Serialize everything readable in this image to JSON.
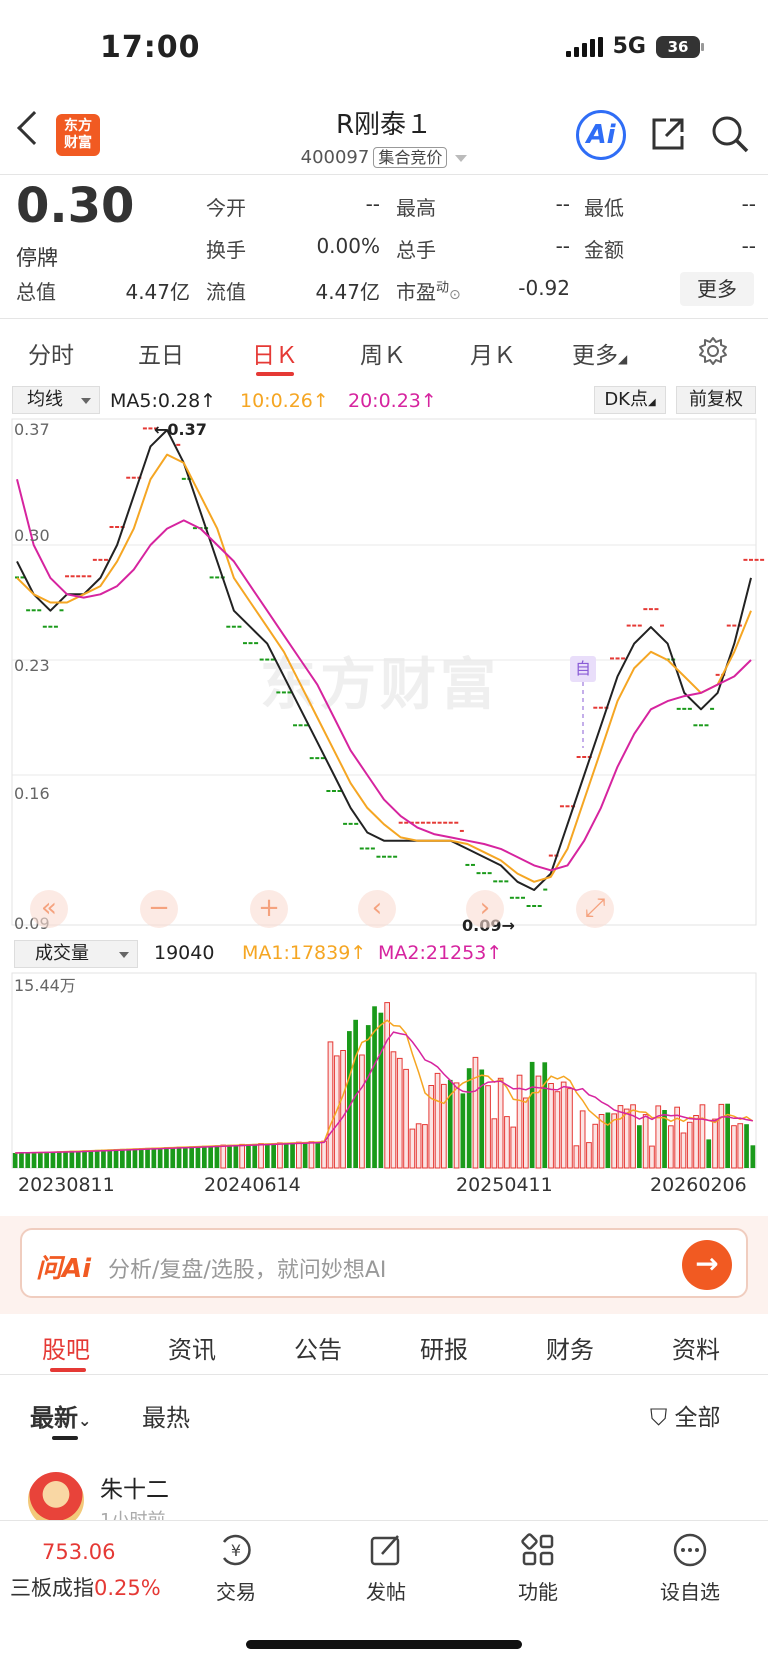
{
  "status_bar": {
    "time": "17:00",
    "network": "5G",
    "battery": "36"
  },
  "header": {
    "stock_name": "R刚泰１",
    "code": "400097",
    "auction_tag": "集合竞价",
    "logo_line1": "东方",
    "logo_line2": "财富",
    "ai_label": "Ai"
  },
  "quote": {
    "price": "0.30",
    "status": "停牌",
    "open_label": "今开",
    "open": "--",
    "high_label": "最高",
    "high": "--",
    "low_label": "最低",
    "low": "--",
    "turnover_label": "换手",
    "turnover": "0.00%",
    "volume_label": "总手",
    "volume": "--",
    "amount_label": "金额",
    "amount": "--",
    "total_cap_label": "总值",
    "total_cap": "4.47亿",
    "float_cap_label": "流值",
    "float_cap": "4.47亿",
    "pe_label": "市盈",
    "pe_sup": "动",
    "pe": "-0.92",
    "more": "更多"
  },
  "period_tabs": [
    "分时",
    "五日",
    "日Ｋ",
    "周Ｋ",
    "月Ｋ",
    "更多"
  ],
  "ma_legend": {
    "select": "均线",
    "ma5": "MA5:0.28↑",
    "ma10": "10:0.26↑",
    "ma20": "20:0.23↑",
    "dk": "DK点",
    "adjust": "前复权",
    "colors": {
      "ma5": "#222222",
      "ma10": "#f5a623",
      "ma20": "#d6249f",
      "up": "#e53935",
      "down": "#1a9a1a"
    }
  },
  "price_axis": {
    "labels": [
      "0.37",
      "0.30",
      "0.23",
      "0.16",
      "0.09"
    ]
  },
  "annotations": {
    "high": "←0.37",
    "low": "0.09→",
    "self_tag": "自",
    "watermark": "东方财富"
  },
  "volume": {
    "select": "成交量",
    "value": "19040",
    "ma1": "MA1:17839↑",
    "ma2": "MA2:21253↑",
    "max_label": "15.44万",
    "dates": [
      "20230811",
      "20240614",
      "20250411",
      "20260206"
    ]
  },
  "chart_data": [
    {
      "type": "line",
      "title": "",
      "series": [
        {
          "name": "MA5",
          "values": [
            0.29,
            0.27,
            0.26,
            0.27,
            0.27,
            0.28,
            0.3,
            0.33,
            0.36,
            0.37,
            0.35,
            0.32,
            0.29,
            0.26,
            0.25,
            0.24,
            0.22,
            0.2,
            0.18,
            0.16,
            0.14,
            0.125,
            0.12,
            0.12,
            0.12,
            0.12,
            0.12,
            0.115,
            0.11,
            0.105,
            0.095,
            0.09,
            0.1,
            0.13,
            0.16,
            0.19,
            0.22,
            0.24,
            0.25,
            0.24,
            0.21,
            0.2,
            0.21,
            0.24,
            0.28
          ]
        },
        {
          "name": "MA10",
          "values": [
            0.28,
            0.27,
            0.265,
            0.265,
            0.27,
            0.275,
            0.29,
            0.31,
            0.34,
            0.355,
            0.35,
            0.33,
            0.31,
            0.28,
            0.265,
            0.25,
            0.235,
            0.215,
            0.195,
            0.175,
            0.155,
            0.14,
            0.13,
            0.122,
            0.12,
            0.12,
            0.12,
            0.118,
            0.113,
            0.108,
            0.1,
            0.095,
            0.098,
            0.115,
            0.145,
            0.175,
            0.205,
            0.225,
            0.235,
            0.23,
            0.22,
            0.21,
            0.215,
            0.235,
            0.26
          ]
        },
        {
          "name": "MA20",
          "values": [
            0.34,
            0.3,
            0.28,
            0.27,
            0.268,
            0.27,
            0.275,
            0.285,
            0.3,
            0.31,
            0.315,
            0.31,
            0.3,
            0.29,
            0.275,
            0.26,
            0.245,
            0.23,
            0.215,
            0.195,
            0.175,
            0.16,
            0.145,
            0.135,
            0.128,
            0.124,
            0.122,
            0.12,
            0.118,
            0.115,
            0.11,
            0.105,
            0.102,
            0.105,
            0.12,
            0.14,
            0.165,
            0.185,
            0.2,
            0.205,
            0.208,
            0.21,
            0.215,
            0.22,
            0.23
          ]
        }
      ],
      "ylim": [
        0.09,
        0.37
      ],
      "high": 0.37,
      "low": 0.09
    },
    {
      "type": "bar",
      "title": "",
      "dates": [
        "20230811",
        "20240614",
        "20250411",
        "20260206"
      ],
      "ylim": [
        0,
        154400
      ],
      "last_value": 19040
    }
  ]
}
